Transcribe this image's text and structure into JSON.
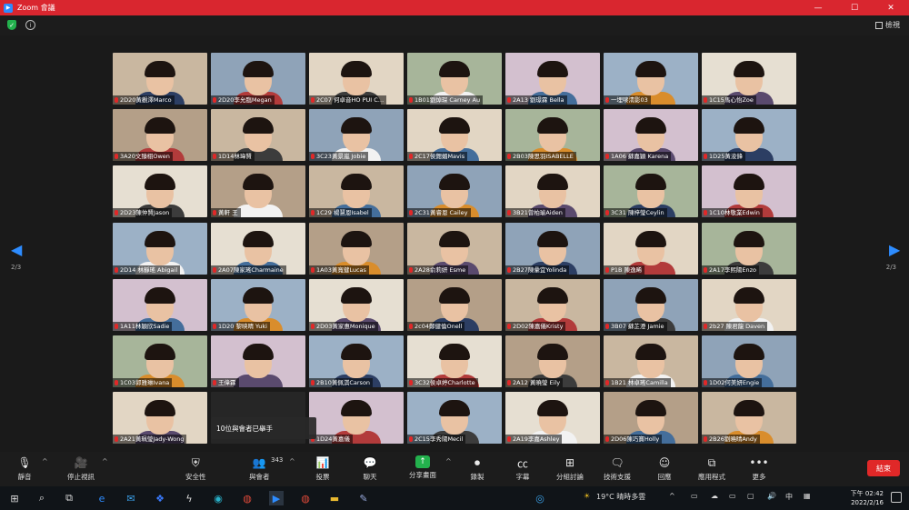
{
  "window": {
    "title": "Zoom 會議"
  },
  "topbar": {
    "view_label": "檢視"
  },
  "gallery": {
    "rows": [
      [
        "2D20黃觀澤Marco",
        "2D20李允臨Megan",
        "2C07 何卓音HO PUI C…",
        "1B01劉焯琛 Carney Au",
        "2A13 劉璟霖 Bella",
        "一埋嘜淸影03",
        "1C15馬心怡Zoe"
      ],
      [
        "3A20文臻栩Owen",
        "1D14林瑋賢",
        "3C23黃景嵐 Jobie",
        "2C17侯鍶媚Mavis",
        "2B03陳思羽ISABELLE",
        "1A06 蘇嘉穎 Karena",
        "1D25黃浚鋒"
      ],
      [
        "2D23陳仲賢Jason",
        "黃軒 王",
        "1C29 楊慧恩Isabel",
        "2C31黃睿恩 Cailey",
        "3B21曾柏瑜Aiden",
        "3C31 陳梓瑩Ceylin",
        "1C10林敬業Edwin"
      ],
      [
        "2D14 林靜瑤 Abigail",
        "2A07陳家瑤Charmaine",
        "1A03黃寬健Lucas",
        "2A28俞莉妍 Esme",
        "2B27陳彙宜Yolinda",
        "P1B 陳逸晞",
        "2A17李熙陽Enzo"
      ],
      [
        "1A11林穎欣Sadie",
        "1D20 黎映晴 Yuki",
        "2D03黃家惠Monique",
        "2c04鄭健倫Onell",
        "2D02陳嘉儀Kristy",
        "3B07 蘇芷澄 Jamie",
        "2b27 陳君龍 Daven"
      ],
      [
        "1C03郭雅琳Ivana",
        "王偉霖",
        "2B10黃佩淇Carson",
        "3C32侯卓婷Charlotte",
        "2A12 黃曉瑩 Eily",
        "1B21 林卓瑤Camilla",
        "1D02何美妍Engie"
      ],
      [
        "2A21黃珮瑩Jady-Wong",
        "",
        "1D24黃嘉儀",
        "2C15李秀陽Mecil",
        "2A19李嘉Ashley",
        "2D06陳巧寶Holly",
        "2B26劉曉晴Andy"
      ]
    ],
    "raise_hand_notice": "10位與會者已舉手",
    "page_indicator_left": "2/3",
    "page_indicator_right": "2/3"
  },
  "toolbar": {
    "mute_label": "靜音",
    "video_label": "停止視訊",
    "security_label": "安全性",
    "participants_label": "與會者",
    "participants_count": "343",
    "polls_label": "投票",
    "chat_label": "聊天",
    "share_label": "分享畫面",
    "record_label": "錄製",
    "captions_label": "字幕",
    "breakout_label": "分組討論",
    "support_label": "技術支援",
    "reactions_label": "回應",
    "apps_label": "應用程式",
    "more_label": "更多",
    "end_label": "結束"
  },
  "taskbar": {
    "weather": "19°C 晴時多雲",
    "time": "下午 02:42",
    "date": "2022/2/16",
    "ime_label": "中"
  },
  "colors": {
    "titlebar": "#d9262f",
    "accent_blue": "#2d8cff",
    "share_green": "#23b14d",
    "end_red": "#e02828"
  }
}
